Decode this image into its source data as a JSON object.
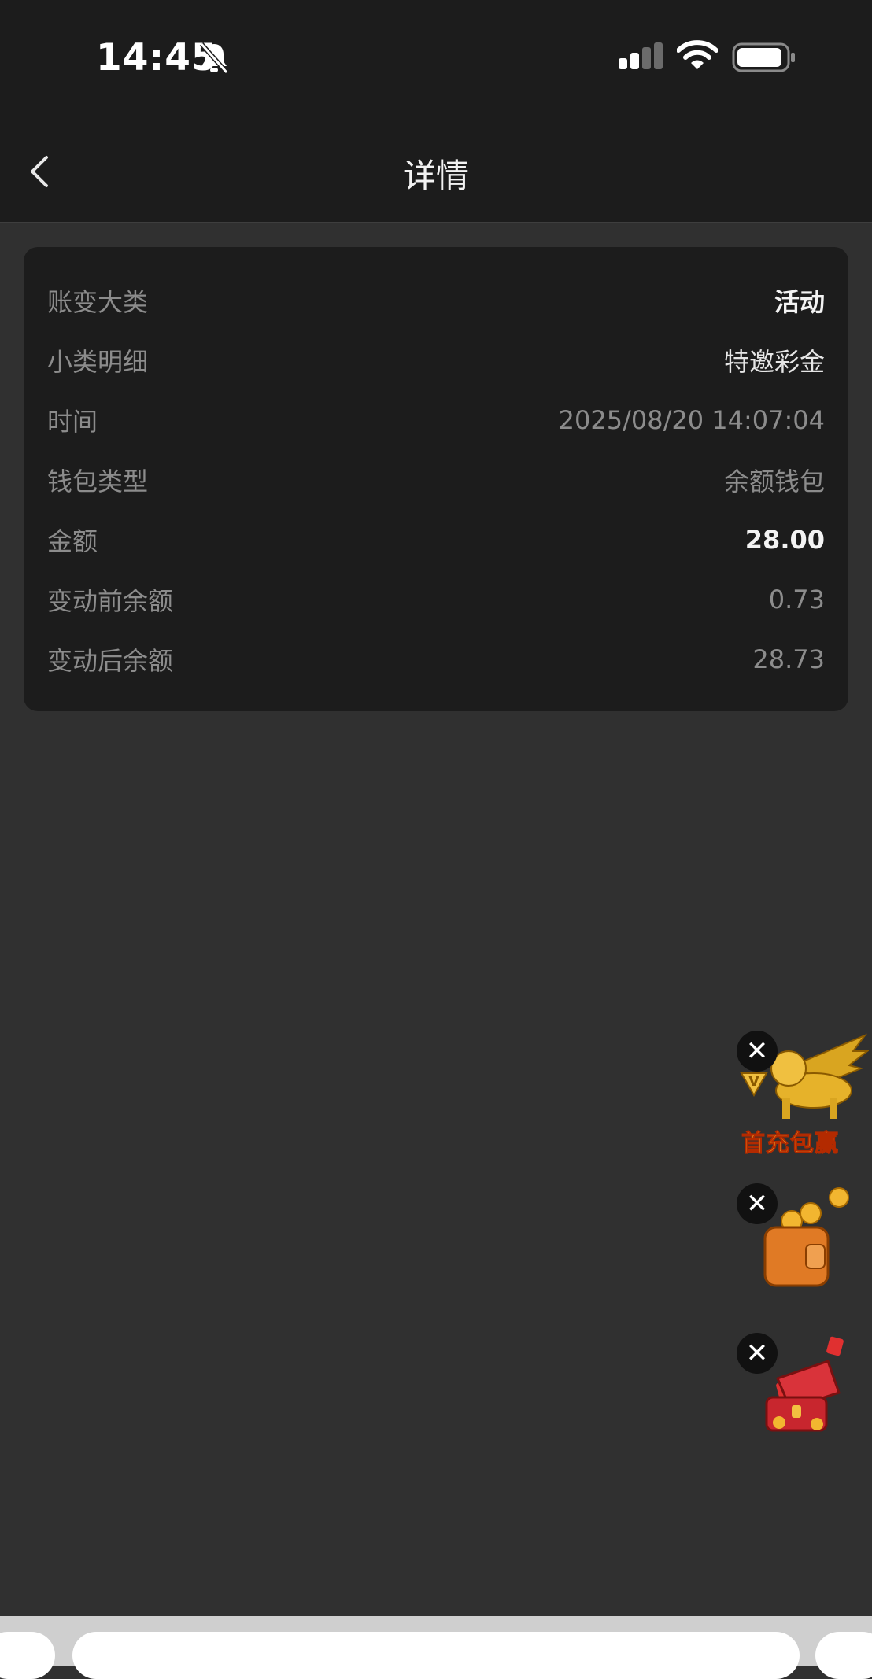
{
  "status_bar": {
    "time": "14:45"
  },
  "nav": {
    "title": "详情"
  },
  "details": [
    {
      "label": "账变大类",
      "value": "活动",
      "style": "strong"
    },
    {
      "label": "小类明细",
      "value": "特邀彩金",
      "style": "light"
    },
    {
      "label": "时间",
      "value": "2025/08/20 14:07:04",
      "style": "muted"
    },
    {
      "label": "钱包类型",
      "value": "余额钱包",
      "style": "muted"
    },
    {
      "label": "金额",
      "value": "28.00",
      "style": "strong"
    },
    {
      "label": "变动前余额",
      "value": "0.73",
      "style": "muted"
    },
    {
      "label": "变动后余额",
      "value": "28.73",
      "style": "muted"
    }
  ],
  "floating": {
    "promo_text": "首充包赢",
    "close_symbol": "✕",
    "icons": [
      "winged-lion-icon",
      "coin-wallet-icon",
      "treasure-chest-icon"
    ]
  },
  "colors": {
    "background": "#303030",
    "bar": "#1c1c1c",
    "card": "#1c1c1c",
    "muted_text": "#8c8c8c"
  }
}
